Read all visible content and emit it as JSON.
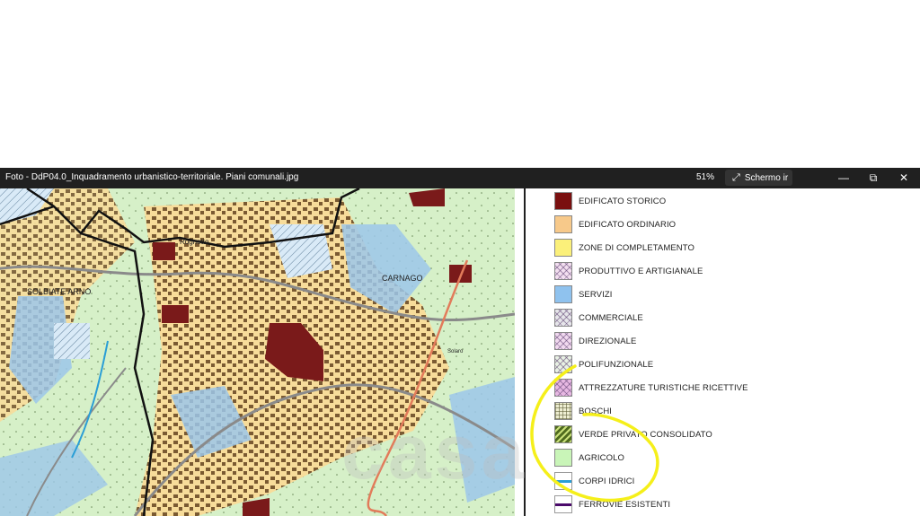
{
  "window": {
    "title": "Foto - DdP04.0_Inquadramento urbanistico-territoriale. Piani comunali.jpg",
    "zoom": "51%",
    "fullscreen_label": "Schermo ir",
    "minimize": "—",
    "restore": "⧉",
    "close": "✕"
  },
  "map": {
    "labels": [
      "SOLBIATE ARNO",
      "CARNAGO",
      "Rognetto",
      "Solaro"
    ]
  },
  "watermark": "casa",
  "legend": {
    "items": [
      {
        "label": "EDIFICATO STORICO",
        "color": "#7a1010"
      },
      {
        "label": "EDIFICATO ORDINARIO",
        "color": "#f7c98a"
      },
      {
        "label": "ZONE DI COMPLETAMENTO",
        "color": "#fbf07a"
      },
      {
        "label": "PRODUTTIVO E ARTIGIANALE",
        "color": "#f3dff0"
      },
      {
        "label": "SERVIZI",
        "color": "#8fc2ee"
      },
      {
        "label": "COMMERCIALE",
        "color": "#e6e6ea"
      },
      {
        "label": "DIREZIONALE",
        "color": "#f1d9ef"
      },
      {
        "label": "POLIFUNZIONALE",
        "color": "#e8f1e4"
      },
      {
        "label": "ATTREZZATURE TURISTICHE RICETTIVE",
        "color": "#e7b8e2"
      },
      {
        "label": "BOSCHI",
        "color": "#eeeed2"
      },
      {
        "label": "VERDE PRIVATO CONSOLIDATO",
        "color": "#4f6b1e"
      },
      {
        "label": "AGRICOLO",
        "color": "#c9f5b8"
      },
      {
        "label": "CORPI IDRICI",
        "color": "#2a9ed6"
      },
      {
        "label": "FERROVIE ESISTENTI",
        "color": "#4b0a6b"
      }
    ]
  },
  "colors": {
    "highlight": "#f5ef1a",
    "titlebar": "#202020"
  }
}
